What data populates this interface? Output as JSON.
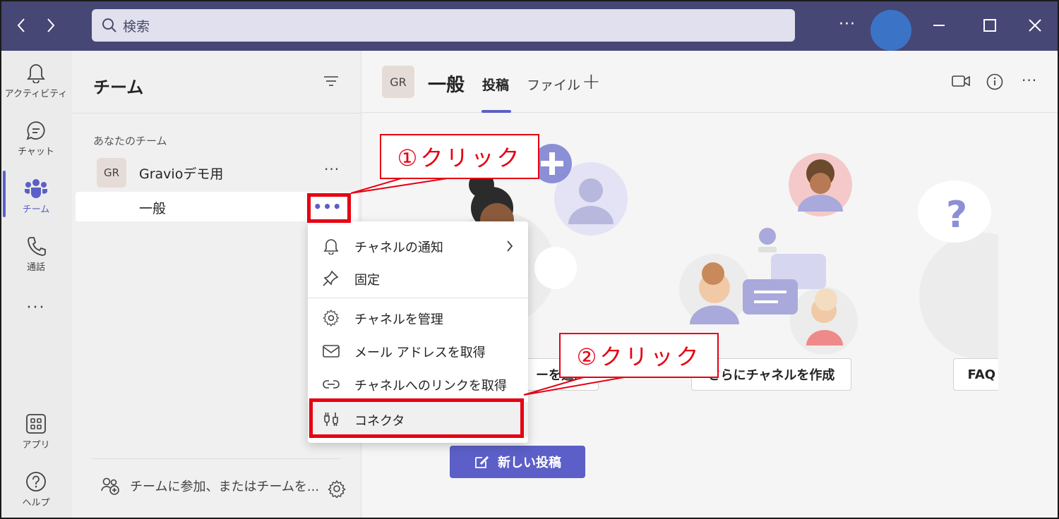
{
  "titlebar": {
    "search_placeholder": "検索",
    "more": "···"
  },
  "rail": {
    "items": [
      {
        "label": "アクティビティ",
        "icon": "bell-icon"
      },
      {
        "label": "チャット",
        "icon": "chat-icon"
      },
      {
        "label": "チーム",
        "icon": "teams-icon",
        "active": true
      },
      {
        "label": "通話",
        "icon": "phone-icon"
      },
      {
        "label": "···",
        "icon": "more-icon"
      },
      {
        "label": "アプリ",
        "icon": "apps-icon"
      },
      {
        "label": "ヘルプ",
        "icon": "help-icon"
      }
    ]
  },
  "panel": {
    "title": "チーム",
    "section_label": "あなたのチーム",
    "team": {
      "avatar": "GR",
      "name": "Gravioデモ用",
      "more": "···"
    },
    "channel": {
      "name": "一般",
      "more": "•••"
    },
    "join_text": "チームに参加、またはチームを..."
  },
  "main": {
    "channel_avatar": "GR",
    "channel_title": "一般",
    "tabs": [
      {
        "label": "投稿",
        "active": true
      },
      {
        "label": "ファイル",
        "active": false
      }
    ],
    "buttons": {
      "add_member": "ーを追加",
      "more_channels": "さらにチャネルを作成",
      "faq": "FAQ",
      "new_post": "新しい投稿"
    }
  },
  "menu": {
    "items": [
      {
        "label": "チャネルの通知",
        "icon": "bell-icon",
        "submenu": true
      },
      {
        "label": "固定",
        "icon": "pin-icon"
      },
      {
        "label": "チャネルを管理",
        "icon": "gear-icon"
      },
      {
        "label": "メール アドレスを取得",
        "icon": "mail-icon"
      },
      {
        "label": "チャネルへのリンクを取得",
        "icon": "link-icon"
      },
      {
        "label": "コネクタ",
        "icon": "connector-icon"
      }
    ]
  },
  "callouts": {
    "step1": "①クリック",
    "step2": "②クリック"
  },
  "colors": {
    "titlebar": "#464775",
    "accent": "#5b5fc7",
    "highlight_red": "#e60012"
  }
}
